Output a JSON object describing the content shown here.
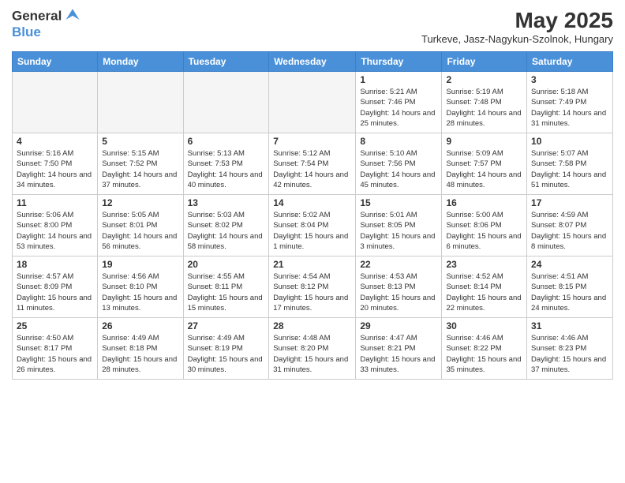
{
  "header": {
    "logo_general": "General",
    "logo_blue": "Blue",
    "month_title": "May 2025",
    "location": "Turkeve, Jasz-Nagykun-Szolnok, Hungary"
  },
  "days_of_week": [
    "Sunday",
    "Monday",
    "Tuesday",
    "Wednesday",
    "Thursday",
    "Friday",
    "Saturday"
  ],
  "weeks": [
    [
      {
        "day": "",
        "info": ""
      },
      {
        "day": "",
        "info": ""
      },
      {
        "day": "",
        "info": ""
      },
      {
        "day": "",
        "info": ""
      },
      {
        "day": "1",
        "info": "Sunrise: 5:21 AM\nSunset: 7:46 PM\nDaylight: 14 hours and 25 minutes."
      },
      {
        "day": "2",
        "info": "Sunrise: 5:19 AM\nSunset: 7:48 PM\nDaylight: 14 hours and 28 minutes."
      },
      {
        "day": "3",
        "info": "Sunrise: 5:18 AM\nSunset: 7:49 PM\nDaylight: 14 hours and 31 minutes."
      }
    ],
    [
      {
        "day": "4",
        "info": "Sunrise: 5:16 AM\nSunset: 7:50 PM\nDaylight: 14 hours and 34 minutes."
      },
      {
        "day": "5",
        "info": "Sunrise: 5:15 AM\nSunset: 7:52 PM\nDaylight: 14 hours and 37 minutes."
      },
      {
        "day": "6",
        "info": "Sunrise: 5:13 AM\nSunset: 7:53 PM\nDaylight: 14 hours and 40 minutes."
      },
      {
        "day": "7",
        "info": "Sunrise: 5:12 AM\nSunset: 7:54 PM\nDaylight: 14 hours and 42 minutes."
      },
      {
        "day": "8",
        "info": "Sunrise: 5:10 AM\nSunset: 7:56 PM\nDaylight: 14 hours and 45 minutes."
      },
      {
        "day": "9",
        "info": "Sunrise: 5:09 AM\nSunset: 7:57 PM\nDaylight: 14 hours and 48 minutes."
      },
      {
        "day": "10",
        "info": "Sunrise: 5:07 AM\nSunset: 7:58 PM\nDaylight: 14 hours and 51 minutes."
      }
    ],
    [
      {
        "day": "11",
        "info": "Sunrise: 5:06 AM\nSunset: 8:00 PM\nDaylight: 14 hours and 53 minutes."
      },
      {
        "day": "12",
        "info": "Sunrise: 5:05 AM\nSunset: 8:01 PM\nDaylight: 14 hours and 56 minutes."
      },
      {
        "day": "13",
        "info": "Sunrise: 5:03 AM\nSunset: 8:02 PM\nDaylight: 14 hours and 58 minutes."
      },
      {
        "day": "14",
        "info": "Sunrise: 5:02 AM\nSunset: 8:04 PM\nDaylight: 15 hours and 1 minute."
      },
      {
        "day": "15",
        "info": "Sunrise: 5:01 AM\nSunset: 8:05 PM\nDaylight: 15 hours and 3 minutes."
      },
      {
        "day": "16",
        "info": "Sunrise: 5:00 AM\nSunset: 8:06 PM\nDaylight: 15 hours and 6 minutes."
      },
      {
        "day": "17",
        "info": "Sunrise: 4:59 AM\nSunset: 8:07 PM\nDaylight: 15 hours and 8 minutes."
      }
    ],
    [
      {
        "day": "18",
        "info": "Sunrise: 4:57 AM\nSunset: 8:09 PM\nDaylight: 15 hours and 11 minutes."
      },
      {
        "day": "19",
        "info": "Sunrise: 4:56 AM\nSunset: 8:10 PM\nDaylight: 15 hours and 13 minutes."
      },
      {
        "day": "20",
        "info": "Sunrise: 4:55 AM\nSunset: 8:11 PM\nDaylight: 15 hours and 15 minutes."
      },
      {
        "day": "21",
        "info": "Sunrise: 4:54 AM\nSunset: 8:12 PM\nDaylight: 15 hours and 17 minutes."
      },
      {
        "day": "22",
        "info": "Sunrise: 4:53 AM\nSunset: 8:13 PM\nDaylight: 15 hours and 20 minutes."
      },
      {
        "day": "23",
        "info": "Sunrise: 4:52 AM\nSunset: 8:14 PM\nDaylight: 15 hours and 22 minutes."
      },
      {
        "day": "24",
        "info": "Sunrise: 4:51 AM\nSunset: 8:15 PM\nDaylight: 15 hours and 24 minutes."
      }
    ],
    [
      {
        "day": "25",
        "info": "Sunrise: 4:50 AM\nSunset: 8:17 PM\nDaylight: 15 hours and 26 minutes."
      },
      {
        "day": "26",
        "info": "Sunrise: 4:49 AM\nSunset: 8:18 PM\nDaylight: 15 hours and 28 minutes."
      },
      {
        "day": "27",
        "info": "Sunrise: 4:49 AM\nSunset: 8:19 PM\nDaylight: 15 hours and 30 minutes."
      },
      {
        "day": "28",
        "info": "Sunrise: 4:48 AM\nSunset: 8:20 PM\nDaylight: 15 hours and 31 minutes."
      },
      {
        "day": "29",
        "info": "Sunrise: 4:47 AM\nSunset: 8:21 PM\nDaylight: 15 hours and 33 minutes."
      },
      {
        "day": "30",
        "info": "Sunrise: 4:46 AM\nSunset: 8:22 PM\nDaylight: 15 hours and 35 minutes."
      },
      {
        "day": "31",
        "info": "Sunrise: 4:46 AM\nSunset: 8:23 PM\nDaylight: 15 hours and 37 minutes."
      }
    ]
  ]
}
